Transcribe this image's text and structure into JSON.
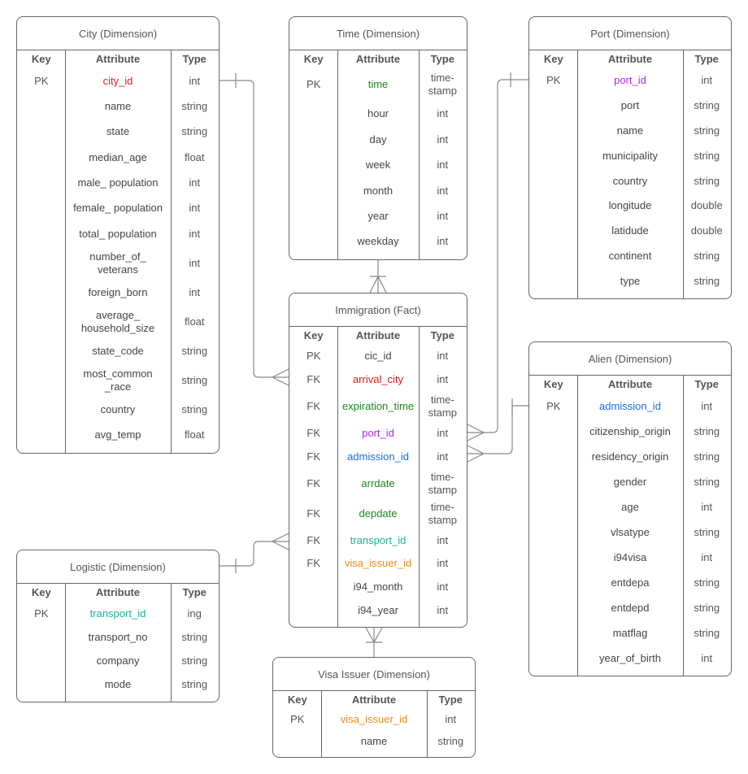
{
  "colors": {
    "red": "#e81a1a",
    "green": "#1a8a1a",
    "purple": "#b026e8",
    "blue": "#1a6ee8",
    "teal": "#17b3a0",
    "orange": "#f08a1a",
    "text": "#333333",
    "line": "#888888"
  },
  "headers": {
    "key": "Key",
    "attribute": "Attribute",
    "type": "Type"
  },
  "tables": {
    "city": {
      "title": "City (Dimension)",
      "rows": [
        {
          "key": "PK",
          "attr": "city_id",
          "type": "int",
          "color": "red"
        },
        {
          "key": "",
          "attr": "name",
          "type": "string"
        },
        {
          "key": "",
          "attr": "state",
          "type": "string"
        },
        {
          "key": "",
          "attr": "median_age",
          "type": "float"
        },
        {
          "key": "",
          "attr": "male_ population",
          "type": "int"
        },
        {
          "key": "",
          "attr": "female_ population",
          "type": "int"
        },
        {
          "key": "",
          "attr": "total_ population",
          "type": "int"
        },
        {
          "key": "",
          "attr": "number_of_\nveterans",
          "type": "int"
        },
        {
          "key": "",
          "attr": "foreign_born",
          "type": "int"
        },
        {
          "key": "",
          "attr": "average_\nhousehold_size",
          "type": "float"
        },
        {
          "key": "",
          "attr": "state_code",
          "type": "string"
        },
        {
          "key": "",
          "attr": "most_common\n_race",
          "type": "string"
        },
        {
          "key": "",
          "attr": "country",
          "type": "string"
        },
        {
          "key": "",
          "attr": "avg_temp",
          "type": "float"
        }
      ]
    },
    "time": {
      "title": "Time (Dimension)",
      "rows": [
        {
          "key": "PK",
          "attr": "time",
          "type": "time-\nstamp",
          "color": "green"
        },
        {
          "key": "",
          "attr": "hour",
          "type": "int"
        },
        {
          "key": "",
          "attr": "day",
          "type": "int"
        },
        {
          "key": "",
          "attr": "week",
          "type": "int"
        },
        {
          "key": "",
          "attr": "month",
          "type": "int"
        },
        {
          "key": "",
          "attr": "year",
          "type": "int"
        },
        {
          "key": "",
          "attr": "weekday",
          "type": "int"
        }
      ]
    },
    "port": {
      "title": "Port (Dimension)",
      "rows": [
        {
          "key": "PK",
          "attr": "port_id",
          "type": "int",
          "color": "purple"
        },
        {
          "key": "",
          "attr": "port",
          "type": "string"
        },
        {
          "key": "",
          "attr": "name",
          "type": "string"
        },
        {
          "key": "",
          "attr": "municipality",
          "type": "string"
        },
        {
          "key": "",
          "attr": "country",
          "type": "string"
        },
        {
          "key": "",
          "attr": "longitude",
          "type": "double"
        },
        {
          "key": "",
          "attr": "latidude",
          "type": "double"
        },
        {
          "key": "",
          "attr": "continent",
          "type": "string"
        },
        {
          "key": "",
          "attr": "type",
          "type": "string"
        }
      ]
    },
    "immigration": {
      "title": "Immigration (Fact)",
      "rows": [
        {
          "key": "PK",
          "attr": "cic_id",
          "type": "int"
        },
        {
          "key": "FK",
          "attr": "arrival_city",
          "type": "int",
          "color": "red"
        },
        {
          "key": "FK",
          "attr": "expiration_time",
          "type": "time-\nstamp",
          "color": "green"
        },
        {
          "key": "FK",
          "attr": "port_id",
          "type": "int",
          "color": "purple"
        },
        {
          "key": "FK",
          "attr": "admission_id",
          "type": "int",
          "color": "blue"
        },
        {
          "key": "FK",
          "attr": "arrdate",
          "type": "time-\nstamp",
          "color": "green"
        },
        {
          "key": "FK",
          "attr": "depdate",
          "type": "time-\nstamp",
          "color": "green"
        },
        {
          "key": "FK",
          "attr": "transport_id",
          "type": "int",
          "color": "teal"
        },
        {
          "key": "FK",
          "attr": "visa_issuer_id",
          "type": "int",
          "color": "orange"
        },
        {
          "key": "",
          "attr": "i94_month",
          "type": "int"
        },
        {
          "key": "",
          "attr": "i94_year",
          "type": "int"
        }
      ]
    },
    "alien": {
      "title": "Alien (Dimension)",
      "rows": [
        {
          "key": "PK",
          "attr": "admission_id",
          "type": "int",
          "color": "blue"
        },
        {
          "key": "",
          "attr": "citizenship_origin",
          "type": "string"
        },
        {
          "key": "",
          "attr": "residency_origin",
          "type": "string"
        },
        {
          "key": "",
          "attr": "gender",
          "type": "string"
        },
        {
          "key": "",
          "attr": "age",
          "type": "int"
        },
        {
          "key": "",
          "attr": "vlsatype",
          "type": "string"
        },
        {
          "key": "",
          "attr": "i94visa",
          "type": "int"
        },
        {
          "key": "",
          "attr": "entdepa",
          "type": "string"
        },
        {
          "key": "",
          "attr": "entdepd",
          "type": "string"
        },
        {
          "key": "",
          "attr": "matflag",
          "type": "string"
        },
        {
          "key": "",
          "attr": "year_of_birth",
          "type": "int"
        }
      ]
    },
    "logistic": {
      "title": "Logistic (Dimension)",
      "rows": [
        {
          "key": "PK",
          "attr": "transport_id",
          "type": "ing",
          "color": "teal"
        },
        {
          "key": "",
          "attr": "transport_no",
          "type": "string"
        },
        {
          "key": "",
          "attr": "company",
          "type": "string"
        },
        {
          "key": "",
          "attr": "mode",
          "type": "string"
        }
      ]
    },
    "visa": {
      "title": "Visa Issuer (Dimension)",
      "rows": [
        {
          "key": "PK",
          "attr": "visa_issuer_id",
          "type": "int",
          "color": "orange"
        },
        {
          "key": "",
          "attr": "name",
          "type": "string"
        }
      ]
    }
  }
}
